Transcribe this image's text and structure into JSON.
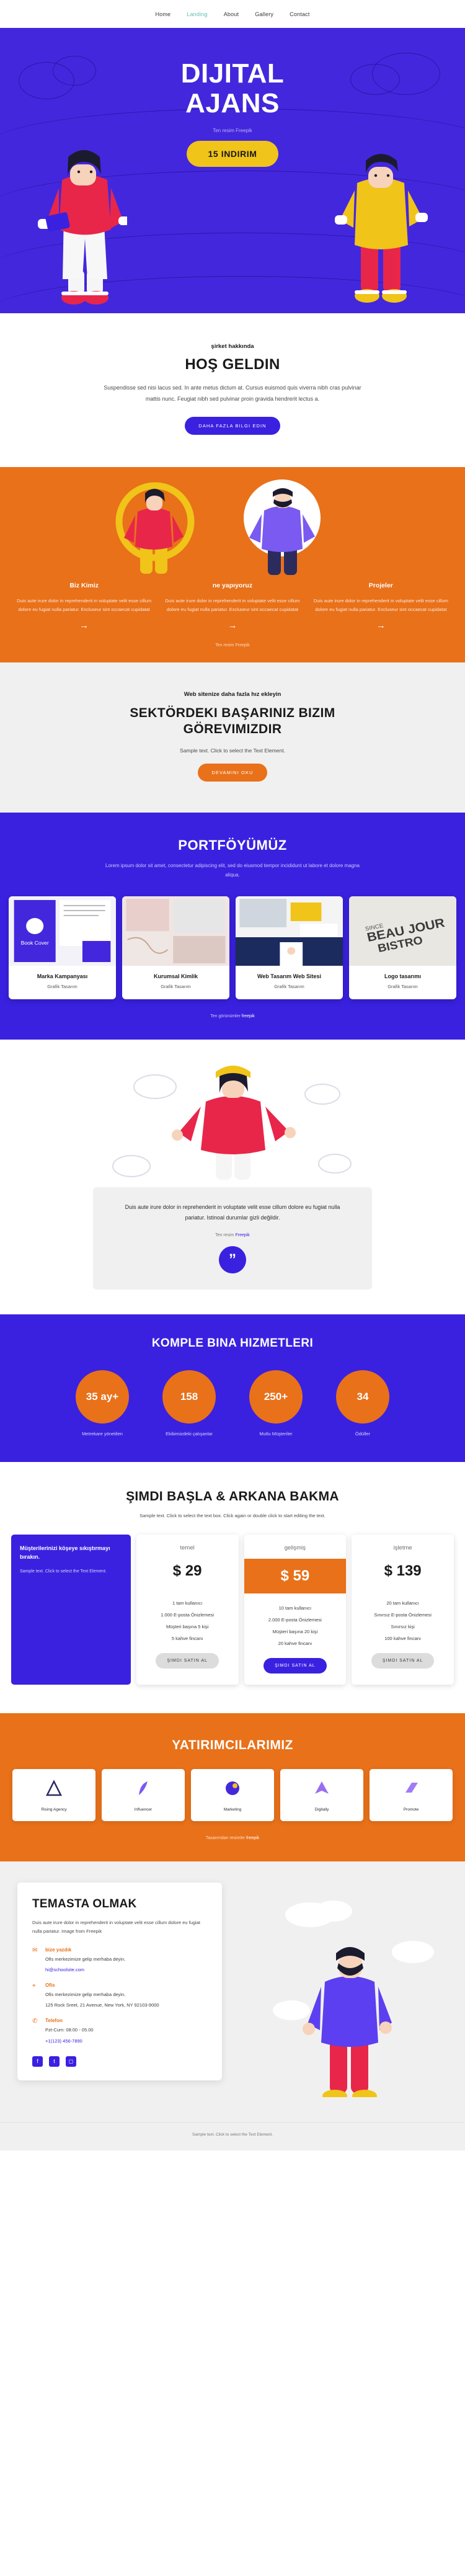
{
  "nav": {
    "items": [
      {
        "label": "Home",
        "active": false
      },
      {
        "label": "Landing",
        "active": true
      },
      {
        "label": "About",
        "active": false
      },
      {
        "label": "Gallery",
        "active": false
      },
      {
        "label": "Contact",
        "active": false
      }
    ]
  },
  "hero": {
    "title_line1": "DIJITAL",
    "title_line2": "AJANS",
    "credit": "Ten resim Freepik",
    "button": "15 INDIRIM"
  },
  "welcome": {
    "eyebrow": "şirket hakkında",
    "title": "HOŞ GELDIN",
    "body": "Suspendisse sed nisi lacus sed. In ante metus dictum at. Cursus euismod quis viverra nibh cras pulvinar mattis nunc. Feugiat nibh sed pulvinar proin gravida hendrerit lectus a.",
    "button": "DAHA FAZLA BILGI EDIN"
  },
  "features": {
    "columns": [
      {
        "title": "Biz Kimiz",
        "body": "Duis aute irure dolor in reprehenderit in voluptate velit esse cillum dolore eu fugiat nulla pariatur. Excluseur sint occaecat cupidatat",
        "arrow": "→"
      },
      {
        "title": "ne yapıyoruz",
        "body": "Duis aute irure dolor in reprehenderit in voluptate velit esse cillum dolore eu fugiat nulla pariatur. Excluseur sint occaecat cupidatat",
        "arrow": "→"
      },
      {
        "title": "Projeler",
        "body": "Duis aute irure dolor in reprehenderit in voluptate velit esse cillum dolore eu fugiat nulla pariatur. Excluseur sint occaecat cupidatat",
        "arrow": "→"
      }
    ],
    "credit": "Ten resim Freepik"
  },
  "mission": {
    "eyebrow": "Web sitenize daha fazla hız ekleyin",
    "title": "SEKTÖRDEKI BAŞARINIZ BIZIM GÖREVIMIZDIR",
    "sample": "Sample text. Click to select the Text Element.",
    "button": "DEVAMINI OKU"
  },
  "portfolio": {
    "title": "PORTFÖYÜMÜZ",
    "lead": "Lorem ipsum dolor sit amet, consectetur adipiscing elit, sed do eiusmod tempor incididunt ut labore et dolore magna aliqua.",
    "cards": [
      {
        "title": "Marka Kampanyası",
        "sub": "Grafik Tasarım",
        "thumb_label": "Book Cover"
      },
      {
        "title": "Kurumsal Kimlik",
        "sub": "Grafik Tasarım",
        "thumb_label": ""
      },
      {
        "title": "Web Tasarım Web Sitesi",
        "sub": "Grafik Tasarım",
        "thumb_label": ""
      },
      {
        "title": "Logo tasarımı",
        "sub": "Grafik Tasarım",
        "thumb_label": "BEAU JOUR BISTRO"
      }
    ],
    "credit_prefix": "Ten görünümler ",
    "credit_brand": "freepik"
  },
  "quote": {
    "text": "Duis aute irure dolor in reprehenderit in voluptate velit esse cillum dolore eu fugiat nulla pariatur. Istinoal durumlar gizli değildir.",
    "credit_prefix": "Ten resim ",
    "credit_brand": "Freepik",
    "mark": "”"
  },
  "stats": {
    "title": "KOMPLE BINA HIZMETLERI",
    "items": [
      {
        "value": "35 ay+",
        "label": "Metrekare yönetilen"
      },
      {
        "value": "158",
        "label": "Ekibimizdeki çalışanlar"
      },
      {
        "value": "250+",
        "label": "Mutlu Müşteriler"
      },
      {
        "value": "34",
        "label": "Ödüller"
      }
    ]
  },
  "pricing": {
    "title": "ŞIMDI BAŞLA & ARKANA BAKMA",
    "sample": "Sample text. Click to select the text box. Click again or double click to start editing the text.",
    "promo": {
      "title": "Müşterilerinizi köşeye sıkıştırmayı bırakın.",
      "body": "Sample text. Click to select the Text Element."
    },
    "plans": [
      {
        "name": "temel",
        "price": "$ 29",
        "featured": false,
        "features": [
          "1 tam kullanıcı",
          "1.000 E-posta Önizlemesi",
          "Müşteri başına 5 kişi",
          "5 kahve fincanı"
        ],
        "button": "ŞIMDI SATIN AL"
      },
      {
        "name": "gelişmiş",
        "price": "$ 59",
        "featured": true,
        "features": [
          "10 tam kullanıcı",
          "2.000 E-posta Önizlemesi",
          "Müşteri başına 20 kişi",
          "20 kahve fincanı"
        ],
        "button": "ŞIMDI SATIN AL"
      },
      {
        "name": "işletme",
        "price": "$ 139",
        "featured": false,
        "features": [
          "20 tam kullanıcı",
          "Sınırsız E-posta Önizlemesi",
          "Sınırsız kişi",
          "100 kahve fincanı"
        ],
        "button": "ŞIMDI SATIN AL"
      }
    ]
  },
  "investors": {
    "title": "YATIRIMCILARIMIZ",
    "logos": [
      {
        "name": "Rising Agency"
      },
      {
        "name": "Influencer"
      },
      {
        "name": "Marketing"
      },
      {
        "name": "Digitally"
      },
      {
        "name": "Promote"
      }
    ],
    "credit_prefix": "Tasarımdan resimler ",
    "credit_brand": "freepik"
  },
  "contact": {
    "title": "TEMASTA OLMAK",
    "intro": "Duis aute irure dolor in reprehenderit in voluptate velit esse cillum dolore eu fugiat nulla pariatur. Image from Freepik",
    "blocks": [
      {
        "icon": "envelope-icon",
        "glyph": "✉",
        "title": "bize yazdık",
        "text": "Ofis",
        "body": "Ofis merkezimize gelip merhaba deyin.",
        "link": "hi@schoolsite.com"
      },
      {
        "icon": "location-icon",
        "glyph": "⌖",
        "title": "Ofis",
        "text": "",
        "body": "Ofis merkezimize gelip merhaba deyin.",
        "link": "125 Rock Sreet, 21 Avenue, New York, NY 92103-9000"
      },
      {
        "icon": "phone-icon",
        "glyph": "✆",
        "title": "Telefon",
        "text": "",
        "body": "Pzt-Cum: 08:00 - 05.00",
        "link": "+1(123) 456-7890"
      }
    ],
    "socials": [
      {
        "name": "facebook-icon",
        "glyph": "f"
      },
      {
        "name": "twitter-icon",
        "glyph": "t"
      },
      {
        "name": "instagram-icon",
        "glyph": "◻"
      }
    ]
  },
  "footer": {
    "text": "Sample text. Click to select the Text Element."
  },
  "colors": {
    "blue": "#3a21e0",
    "hero_blue": "#4327dd",
    "orange": "#e8711a",
    "yellow": "#f0c419",
    "red": "#e8264a",
    "light": "#f1f0f0",
    "teal": "#63bfae"
  }
}
